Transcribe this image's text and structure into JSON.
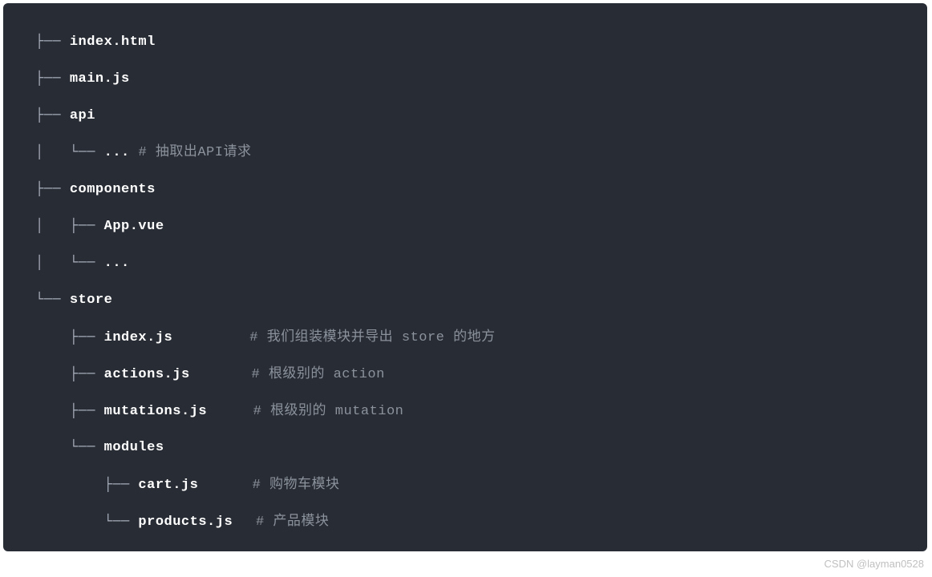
{
  "tree": [
    {
      "prefix": "├── ",
      "name": "index.html",
      "pad": "",
      "comment": ""
    },
    {
      "prefix": "├── ",
      "name": "main.js",
      "pad": "",
      "comment": ""
    },
    {
      "prefix": "├── ",
      "name": "api",
      "pad": "",
      "comment": ""
    },
    {
      "prefix": "│   └── ",
      "name": "... ",
      "pad": "",
      "comment": "# 抽取出API请求"
    },
    {
      "prefix": "├── ",
      "name": "components",
      "pad": "",
      "comment": ""
    },
    {
      "prefix": "│   ├── ",
      "name": "App.vue",
      "pad": "",
      "comment": ""
    },
    {
      "prefix": "│   └── ",
      "name": "...",
      "pad": "",
      "comment": ""
    },
    {
      "prefix": "└── ",
      "name": "store",
      "pad": "",
      "comment": ""
    },
    {
      "prefix": "    ├── ",
      "name": "index.js",
      "pad": "          ",
      "comment": "# 我们组装模块并导出 store 的地方"
    },
    {
      "prefix": "    ├── ",
      "name": "actions.js",
      "pad": "        ",
      "comment": "# 根级别的 action"
    },
    {
      "prefix": "    ├── ",
      "name": "mutations.js",
      "pad": "      ",
      "comment": "# 根级别的 mutation"
    },
    {
      "prefix": "    └── ",
      "name": "modules",
      "pad": "",
      "comment": ""
    },
    {
      "prefix": "        ├── ",
      "name": "cart.js",
      "pad": "       ",
      "comment": "# 购物车模块"
    },
    {
      "prefix": "        └── ",
      "name": "products.js",
      "pad": "   ",
      "comment": "# 产品模块"
    }
  ],
  "watermark": "CSDN @layman0528"
}
